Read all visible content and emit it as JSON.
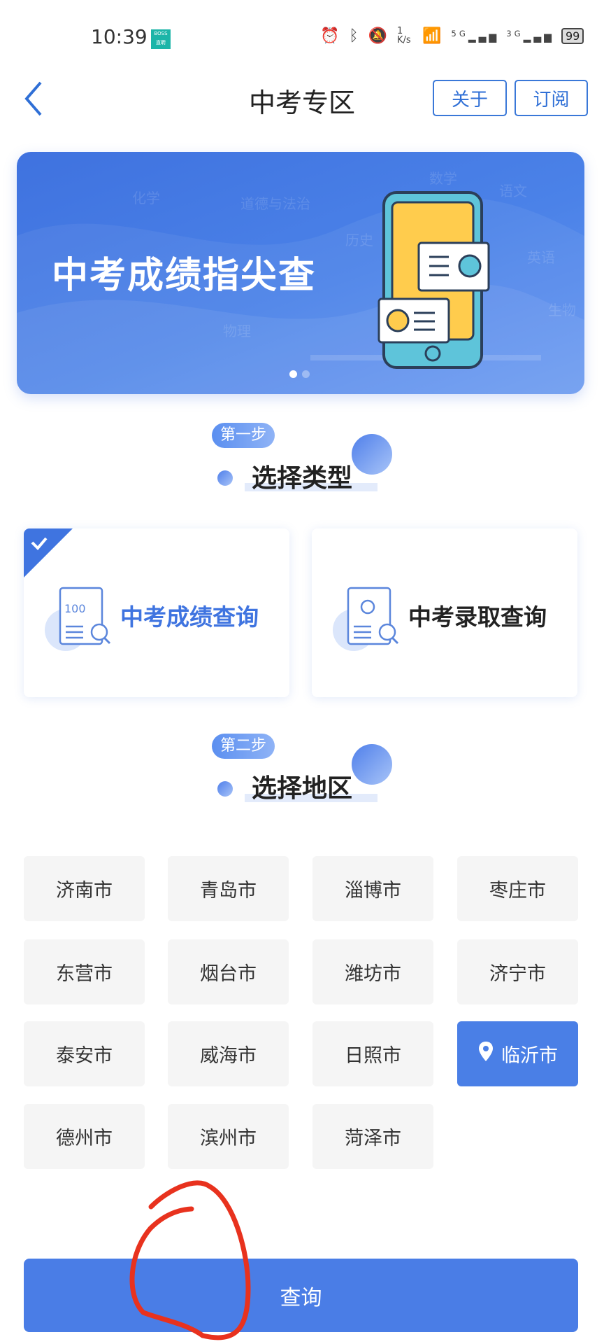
{
  "status_bar": {
    "time": "10:39",
    "app_badge": "BOSS直聘",
    "net_speed": "1 K/s",
    "signal_1": "5G",
    "signal_2": "3G",
    "battery": "99",
    "icons": [
      "alarm-icon",
      "bluetooth-icon",
      "mute-icon",
      "wifi-icon",
      "signal-icon",
      "battery-icon"
    ]
  },
  "header": {
    "title": "中考专区",
    "about_label": "关于",
    "subscribe_label": "订阅"
  },
  "banner": {
    "title": "中考成绩指尖查",
    "watermarks": [
      "化学",
      "道德与法治",
      "数学",
      "语文",
      "历史",
      "英语",
      "生物",
      "物理"
    ],
    "pages": 2,
    "active_page": 1
  },
  "step1": {
    "badge": "第一步",
    "title": "选择类型",
    "options": [
      {
        "label": "中考成绩查询",
        "selected": true,
        "icon_text": "100"
      },
      {
        "label": "中考录取查询",
        "selected": false
      }
    ]
  },
  "step2": {
    "badge": "第二步",
    "title": "选择地区",
    "cities": [
      "济南市",
      "青岛市",
      "淄博市",
      "枣庄市",
      "东营市",
      "烟台市",
      "潍坊市",
      "济宁市",
      "泰安市",
      "威海市",
      "日照市",
      "临沂市",
      "德州市",
      "滨州市",
      "菏泽市"
    ],
    "selected_city": "临沂市"
  },
  "query_label": "查询",
  "colors": {
    "accent": "#4a7de6",
    "annotation": "#e8321e"
  }
}
